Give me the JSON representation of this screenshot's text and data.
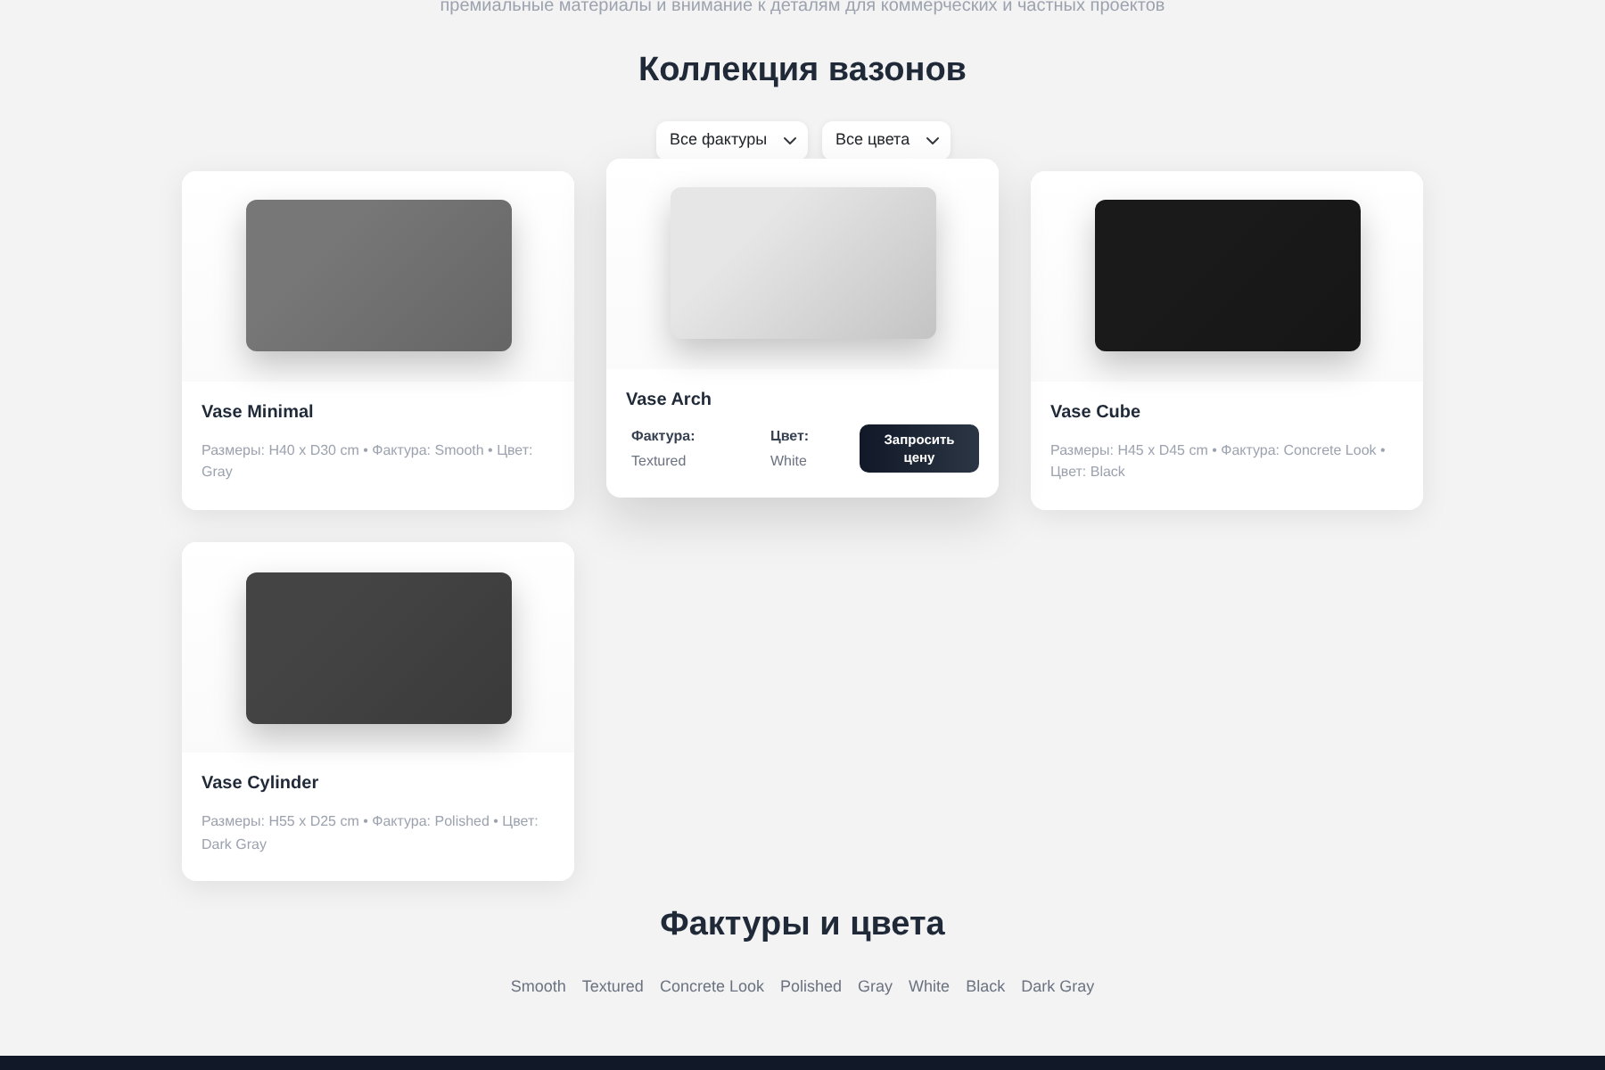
{
  "intro": {
    "subtitle": "премиальные материалы и внимание к деталям для коммерческих и частных проектов"
  },
  "collection": {
    "title": "Коллекция вазонов",
    "filters": [
      {
        "value": "Все фактуры"
      },
      {
        "value": "Все цвета"
      }
    ],
    "vases": [
      {
        "kind": "summary",
        "name": "Vase Minimal",
        "color": "#777777",
        "description": "Размеры: H40 x D30 cm • Фактура: Smooth • Цвет: Gray"
      },
      {
        "kind": "detail",
        "name": "Vase Arch",
        "color": "#e6e6e6",
        "texture_label": "Фактура:",
        "texture": "Textured",
        "color_label": "Цвет:",
        "color_name": "White",
        "button": "Запросить цену"
      },
      {
        "kind": "summary",
        "name": "Vase Cube",
        "color": "#1a1a1a",
        "description": "Размеры: H45 x D45 cm • Фактура: Concrete Look • Цвет: Black"
      },
      {
        "kind": "summary",
        "name": "Vase Cylinder",
        "color": "#444444",
        "description": "Размеры: H55 x D25 cm • Фактура: Polished • Цвет: Dark Gray"
      }
    ]
  },
  "finishes": {
    "title": "Фактуры и цвета",
    "tags": [
      "Smooth",
      "Textured",
      "Concrete Look",
      "Polished",
      "Gray",
      "White",
      "Black",
      "Dark Gray"
    ]
  }
}
